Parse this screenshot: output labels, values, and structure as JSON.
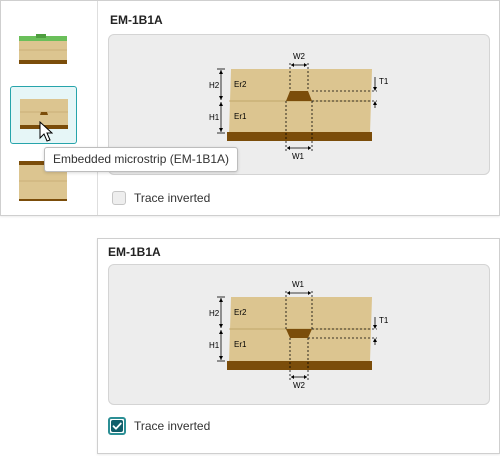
{
  "top_panel": {
    "title": "EM-1B1A",
    "diagram": {
      "labels": {
        "h2": "H2",
        "h1": "H1",
        "er2": "Er2",
        "er1": "Er1",
        "t1": "T1",
        "w_top": "W2",
        "w_bottom": "W1"
      }
    },
    "checkbox": {
      "label": "Trace inverted",
      "checked": false
    }
  },
  "bottom_panel": {
    "title": "EM-1B1A",
    "diagram": {
      "labels": {
        "h2": "H2",
        "h1": "H1",
        "er2": "Er2",
        "er1": "Er1",
        "t1": "T1",
        "w_top": "W1",
        "w_bottom": "W2"
      }
    },
    "checkbox": {
      "label": "Trace inverted",
      "checked": true
    }
  },
  "thumbnails": [
    {
      "name": "surface-microstrip",
      "selected": false
    },
    {
      "name": "embedded-microstrip",
      "selected": true
    },
    {
      "name": "stripline",
      "selected": false
    }
  ],
  "tooltip": {
    "text": "Embedded microstrip (EM-1B1A)"
  },
  "colors": {
    "accent": "#27a4ab",
    "checkbox_fill": "#115e6a",
    "dielectric": "#dcc590",
    "copper_dark": "#7b4d0a",
    "solder_mask": "#6abf5a"
  }
}
